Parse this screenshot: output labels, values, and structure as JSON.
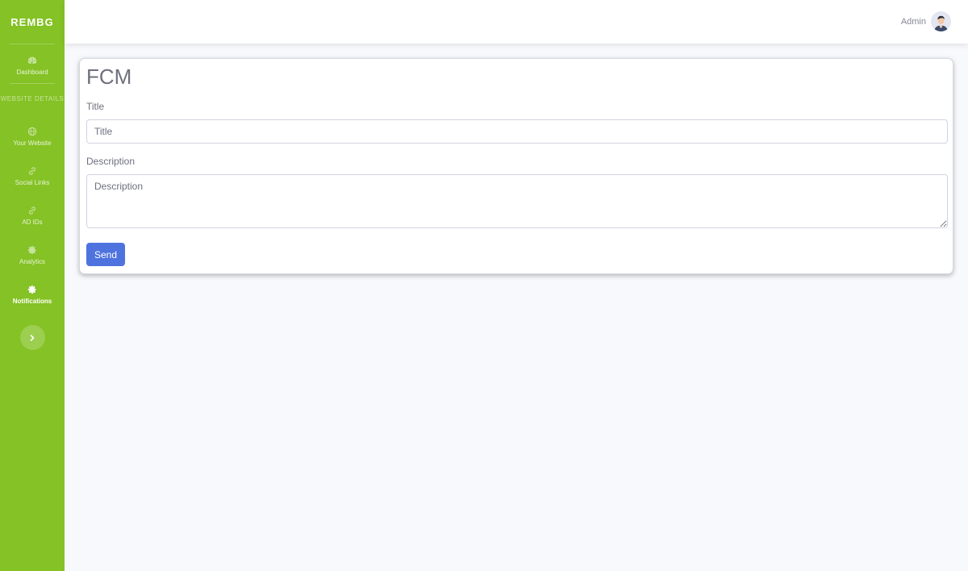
{
  "sidebar": {
    "brand": "REMBG",
    "heading": "WEBSITE DETAILS",
    "items": [
      {
        "label": "Dashboard",
        "icon": "dashboard-icon"
      },
      {
        "label": "Your Website",
        "icon": "globe-icon"
      },
      {
        "label": "Social Links",
        "icon": "link-icon"
      },
      {
        "label": "AD IDs",
        "icon": "link-icon"
      },
      {
        "label": "Analytics",
        "icon": "gear-icon"
      },
      {
        "label": "Notifications",
        "icon": "gear-icon",
        "active": true
      }
    ],
    "toggle_icon": "chevron-right-icon"
  },
  "topbar": {
    "user_name": "Admin",
    "avatar_icon": "user-avatar"
  },
  "form": {
    "title": "FCM",
    "title_label": "Title",
    "title_placeholder": "Title",
    "description_label": "Description",
    "description_placeholder": "Description",
    "send_label": "Send"
  },
  "colors": {
    "sidebar": "#84c225",
    "primary_button": "#4e73df",
    "background": "#f8f9fc"
  }
}
